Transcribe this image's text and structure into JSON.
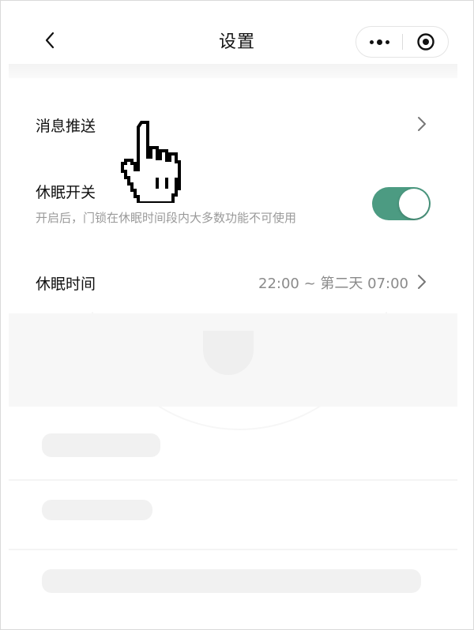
{
  "navbar": {
    "title": "设置",
    "back_icon": "chevron-left-icon",
    "more_icon": "more-dots-icon",
    "close_icon": "target-circle-icon"
  },
  "settings": {
    "message_push": {
      "label": "消息推送"
    },
    "sleep_switch": {
      "label": "休眠开关",
      "description": "开启后，门锁在休眠时间段内大多数功能不可使用",
      "enabled": true
    },
    "sleep_time": {
      "label": "休眠时间",
      "value": "22:00 ~ 第二天 07:00"
    }
  },
  "colors": {
    "toggle_on": "#4c9b82",
    "text_primary": "#111111",
    "text_secondary": "#9a9a9a"
  },
  "cursor": {
    "icon": "hand-pointer-icon"
  }
}
